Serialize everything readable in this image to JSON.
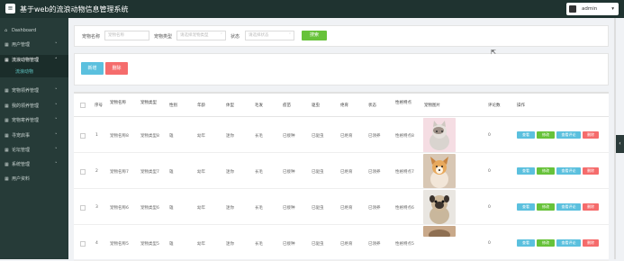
{
  "app": {
    "title": "基于web的流浪动物信息管理系统",
    "user": "admin"
  },
  "sidebar": {
    "items": [
      {
        "label": "Dashboard",
        "icon": "home-icon"
      },
      {
        "label": "用户管理",
        "icon": "grid-icon"
      },
      {
        "label": "流浪动物管理",
        "icon": "grid-icon",
        "active": true
      },
      {
        "label": "宠物领养管理",
        "icon": "grid-icon"
      },
      {
        "label": "我的领养管理",
        "icon": "grid-icon"
      },
      {
        "label": "宠物寄养管理",
        "icon": "grid-icon"
      },
      {
        "label": "寻宠启事",
        "icon": "grid-icon"
      },
      {
        "label": "论坛管理",
        "icon": "grid-icon"
      },
      {
        "label": "系统管理",
        "icon": "grid-icon"
      },
      {
        "label": "用户资料",
        "icon": "grid-icon"
      }
    ],
    "sub_item": "流浪动物"
  },
  "search": {
    "name_label": "宠物名称",
    "name_placeholder": "宠物名称",
    "type_label": "宠物类型",
    "type_placeholder": "请选择宠物类型",
    "status_label": "状态",
    "status_placeholder": "请选择状态",
    "button": "搜索"
  },
  "toolbar": {
    "add": "新增",
    "delete": "删除"
  },
  "table": {
    "headers": [
      "序号",
      "宠物名称",
      "宠物类型",
      "性别",
      "年龄",
      "体型",
      "毛发",
      "疫苗",
      "驱虫",
      "绝育",
      "状态",
      "性格特点",
      "宠物图片",
      "评论数",
      "操作"
    ],
    "rows": [
      {
        "no": "1",
        "name": "宠物名称8",
        "type": "宠物类型8",
        "gender": "雄",
        "age": "幼年",
        "size": "迷你",
        "hair": "长毛",
        "vaccine": "已接种",
        "deworm": "已驱虫",
        "neuter": "已绝育",
        "status": "已领养",
        "trait": "性格特点8",
        "comments": "0"
      },
      {
        "no": "2",
        "name": "宠物名称7",
        "type": "宠物类型7",
        "gender": "雄",
        "age": "幼年",
        "size": "迷你",
        "hair": "长毛",
        "vaccine": "已接种",
        "deworm": "已驱虫",
        "neuter": "已绝育",
        "status": "已领养",
        "trait": "性格特点7",
        "comments": "0"
      },
      {
        "no": "3",
        "name": "宠物名称6",
        "type": "宠物类型6",
        "gender": "雄",
        "age": "幼年",
        "size": "迷你",
        "hair": "长毛",
        "vaccine": "已接种",
        "deworm": "已驱虫",
        "neuter": "已绝育",
        "status": "已领养",
        "trait": "性格特点6",
        "comments": "0"
      },
      {
        "no": "4",
        "name": "宠物名称5",
        "type": "宠物类型5",
        "gender": "雄",
        "age": "幼年",
        "size": "迷你",
        "hair": "长毛",
        "vaccine": "已接种",
        "deworm": "已驱虫",
        "neuter": "已绝育",
        "status": "已领养",
        "trait": "性格特点5",
        "comments": "0"
      }
    ],
    "actions": {
      "view": "查看",
      "edit": "修改",
      "comments": "查看评论",
      "delete": "删除"
    }
  },
  "colors": {
    "topbar": "#1f3330",
    "sidebar": "#263b38",
    "search_btn": "#67c23a",
    "add_btn": "#5bc0de",
    "delete_btn": "#f56c6c"
  }
}
